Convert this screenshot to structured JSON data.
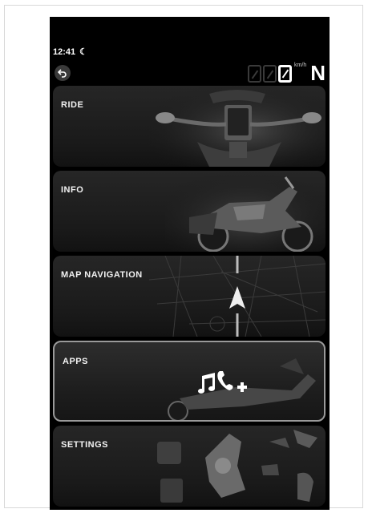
{
  "status": {
    "time": "12:41",
    "night_icon": "moon-icon"
  },
  "speedometer": {
    "digits": [
      "",
      "",
      "0"
    ],
    "unit": "km/h",
    "gear": "N"
  },
  "menu": [
    {
      "label": "RIDE",
      "selected": false
    },
    {
      "label": "INFO",
      "selected": false
    },
    {
      "label": "MAP NAVIGATION",
      "selected": false
    },
    {
      "label": "APPS",
      "selected": true
    },
    {
      "label": "SETTINGS",
      "selected": false
    }
  ],
  "colors": {
    "background": "#000000",
    "tile": "#222222",
    "selected_border": "#9a9a9a",
    "text": "#ffffff"
  }
}
